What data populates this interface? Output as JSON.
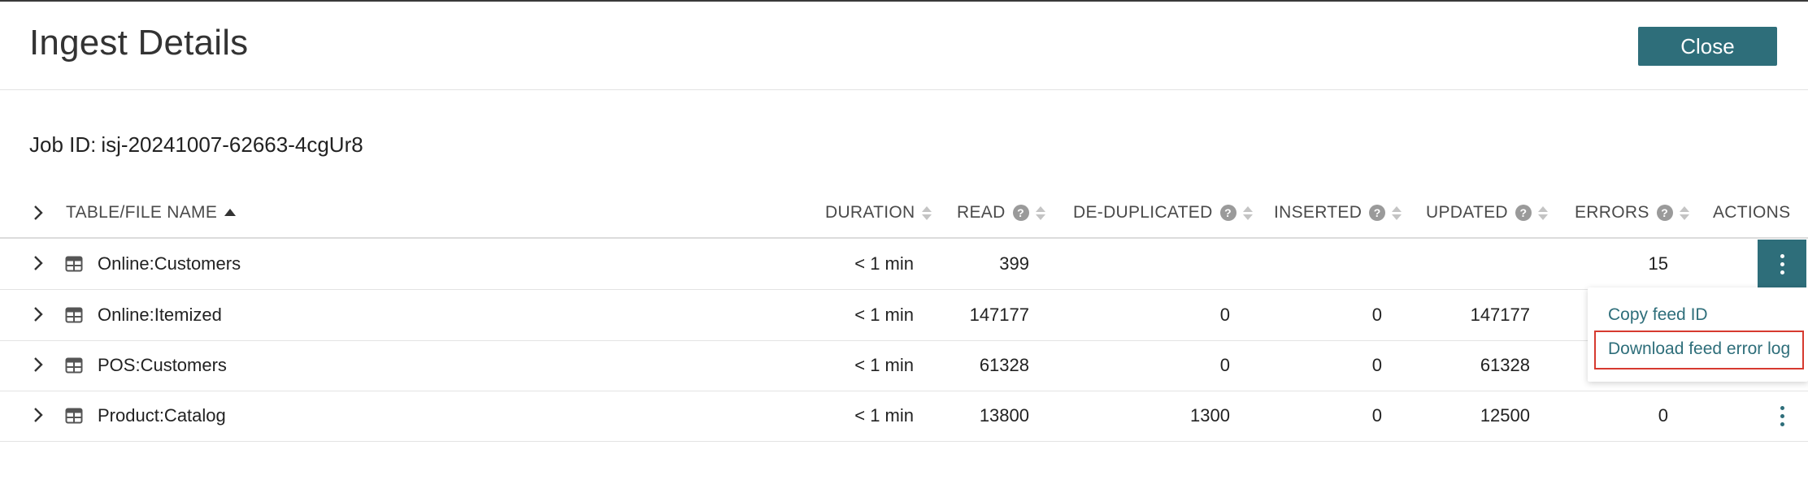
{
  "header": {
    "title": "Ingest Details",
    "close_label": "Close"
  },
  "job": {
    "label": "Job ID:",
    "value": "isj-20241007-62663-4cgUr8"
  },
  "columns": {
    "name": "TABLE/FILE NAME",
    "duration": "DURATION",
    "read": "READ",
    "deduplicated": "DE-DUPLICATED",
    "inserted": "INSERTED",
    "updated": "UPDATED",
    "errors": "ERRORS",
    "actions": "ACTIONS",
    "help_glyph": "?"
  },
  "rows": [
    {
      "name": "Online:Customers",
      "duration": "< 1 min",
      "read": "399",
      "deduplicated": "",
      "inserted": "",
      "updated": "",
      "errors": "15"
    },
    {
      "name": "Online:Itemized",
      "duration": "< 1 min",
      "read": "147177",
      "deduplicated": "0",
      "inserted": "0",
      "updated": "147177",
      "errors": ""
    },
    {
      "name": "POS:Customers",
      "duration": "< 1 min",
      "read": "61328",
      "deduplicated": "0",
      "inserted": "0",
      "updated": "61328",
      "errors": ""
    },
    {
      "name": "Product:Catalog",
      "duration": "< 1 min",
      "read": "13800",
      "deduplicated": "1300",
      "inserted": "0",
      "updated": "12500",
      "errors": "0"
    }
  ],
  "action_menu": {
    "items": [
      {
        "label": "Copy feed ID"
      },
      {
        "label": "Download feed error log",
        "highlighted": true
      }
    ]
  },
  "colors": {
    "accent": "#2e6e7a",
    "highlight_border": "#d63a2f"
  },
  "icons": [
    "chevron-right-icon",
    "table-icon",
    "help-icon",
    "sort-icon",
    "sort-ascending-icon",
    "kebab-menu-icon"
  ]
}
